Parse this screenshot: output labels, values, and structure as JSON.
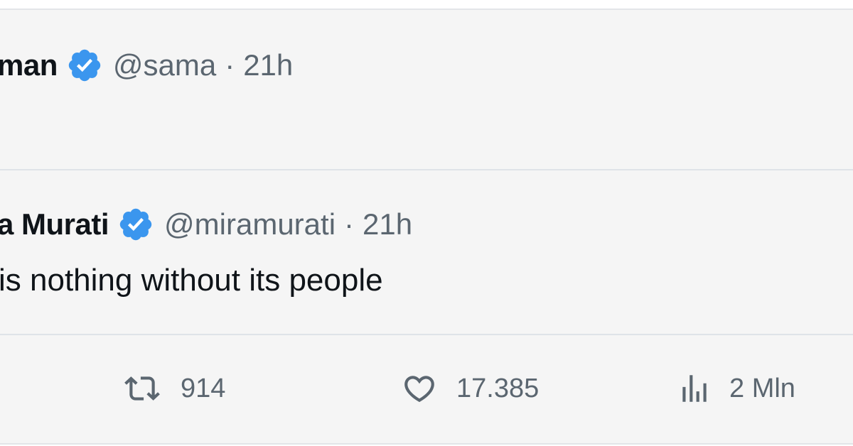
{
  "main_tweet": {
    "name_fragment": "man",
    "handle": "@sama",
    "separator": "·",
    "time": "21h"
  },
  "quoted_tweet": {
    "name_fragment": "a Murati",
    "handle": "@miramurati",
    "separator": "·",
    "time": "21h",
    "text_fragment": "is nothing without its people"
  },
  "actions": {
    "retweets": "914",
    "likes": "17.385",
    "views": "2 Mln"
  },
  "icons": {
    "verified": "verified-badge-icon",
    "retweet": "retweet-icon",
    "like": "heart-icon",
    "views": "views-chart-icon"
  },
  "colors": {
    "verified_blue": "#3b96ee",
    "text_primary": "#0f1419",
    "text_secondary": "#5b6670",
    "background": "#f5f5f5"
  }
}
